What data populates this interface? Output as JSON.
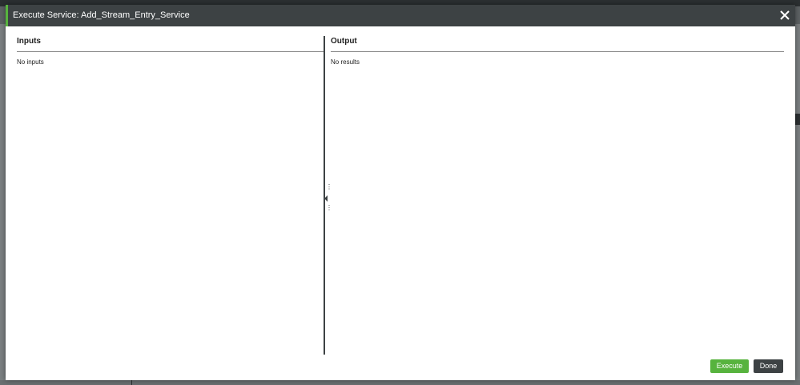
{
  "modal": {
    "title": "Execute Service: Add_Stream_Entry_Service",
    "close_icon": "close-icon"
  },
  "inputs": {
    "title": "Inputs",
    "empty_text": "No inputs"
  },
  "output": {
    "title": "Output",
    "empty_text": "No results"
  },
  "footer": {
    "execute_label": "Execute",
    "done_label": "Done"
  },
  "colors": {
    "header_bg": "#3d4244",
    "accent_green": "#57b33e",
    "done_bg": "#3d4244"
  }
}
